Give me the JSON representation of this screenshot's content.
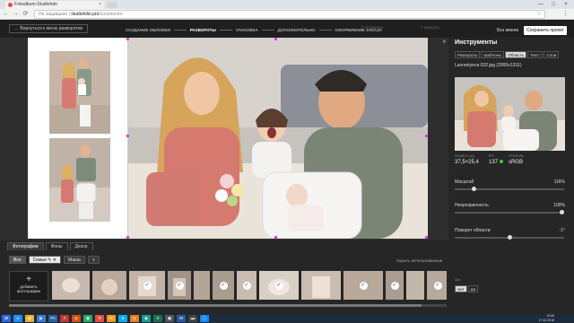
{
  "browser": {
    "tab_title": "Fotoalbum-Studiofoto",
    "tab_close": "×",
    "url_warning": "Не защищено",
    "url_host": "studiofolio.pro",
    "url_path": "/constructor",
    "back_arrow": "←",
    "forward_arrow": "→",
    "reload": "⟳",
    "star": "☆",
    "menu": "⋮",
    "minimize": "—",
    "maximize": "□",
    "close": "×"
  },
  "apptop": {
    "back_label": "← Вернуться к меню разворотов",
    "steps": [
      "СОЗДАНИЕ ОБЛОЖКИ",
      "РАЗВОРОТЫ",
      "УПАКОВКА",
      "ДОПОЛНИТЕЛЬНО",
      "ОФОРМЛЕНИЕ ЗАКАЗА"
    ],
    "active_step": 1,
    "undo_label": "↶ Отменить",
    "redo_label": "↷ Вернуть",
    "user_label": "Без имени",
    "save_label": "Сохранить проект"
  },
  "workspace": {
    "close": "×",
    "bottom_tabs": [
      "Фотографии",
      "Фоны",
      "Декор"
    ],
    "active_tab": 0,
    "filters": [
      "Все",
      "Семья",
      "Маша"
    ],
    "filter_edit": "✎",
    "filter_close": "✕",
    "filter_add": "+",
    "hide_used_label": "Скрыть использованные",
    "add_photo_plus": "+",
    "add_photo_label": "добавить фотографии",
    "thumb_check": "✓"
  },
  "panel": {
    "title": "Инструменты",
    "tabs": [
      "Развороты",
      "Шаблоны",
      "Область",
      "Текст",
      "Слои"
    ],
    "active_tab": 2,
    "filename": "Lavrentyeva 032.jpg (2000x1331)",
    "metrics": [
      {
        "label": "РАЗМЕР (см)",
        "value": "37,5×25,4"
      },
      {
        "label": "PPI",
        "value": "137"
      },
      {
        "label": "ПРОФИЛЬ",
        "value": "sRGB"
      }
    ],
    "sliders": [
      {
        "label": "Масштаб",
        "value": "116%",
        "level": 0.16
      },
      {
        "label": "Непрозрачность",
        "value": "100%",
        "level": 1.0
      },
      {
        "label": "Поворот области",
        "value": "-1°",
        "level": 0.5
      }
    ],
    "unit_label": "Шаг",
    "units": [
      "Нет",
      "Да"
    ],
    "active_unit": 0
  },
  "taskbar": {
    "icons": [
      "⊞",
      "e",
      "📁",
      "▶",
      "Ps",
      "A",
      "◎",
      "◉",
      "Я",
      "✉",
      "S",
      "◎",
      "◉",
      "X",
      "▣",
      "W",
      "▬",
      "◯"
    ],
    "time": "13:55",
    "date": "17.02.2018"
  },
  "colors": {
    "accent_step": "#ffffff",
    "selection_handle": "#e040e0",
    "ppi_ok": "#33cc33"
  }
}
